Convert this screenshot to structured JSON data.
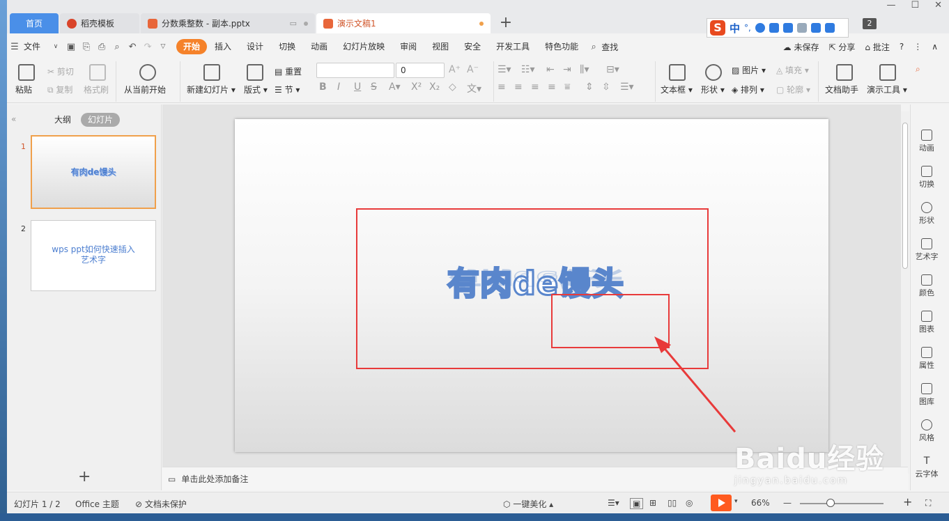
{
  "tabs": {
    "home": "首页",
    "t1": "稻壳模板",
    "t2": "分数乘整数 - 副本.pptx",
    "t3": "演示文稿1"
  },
  "ime": {
    "zh": "中"
  },
  "badge": "2",
  "menu": {
    "file": "文件",
    "items": [
      "开始",
      "插入",
      "设计",
      "切换",
      "动画",
      "幻灯片放映",
      "审阅",
      "视图",
      "安全",
      "开发工具",
      "特色功能"
    ],
    "search": "查找",
    "unsaved": "未保存",
    "share": "分享",
    "comment": "批注"
  },
  "ribbon": {
    "paste": "粘贴",
    "cut": "剪切",
    "copy": "复制",
    "format_painter": "格式刷",
    "from_current": "从当前开始",
    "new_slide": "新建幻灯片",
    "layout": "版式",
    "reset": "重置",
    "section": "节",
    "font_size": "0",
    "textbox": "文本框",
    "shape": "形状",
    "picture": "图片",
    "fill": "填充",
    "arrange": "排列",
    "outline": "轮廓",
    "doc_helper": "文档助手",
    "present_tools": "演示工具"
  },
  "leftpanel": {
    "outline_tab": "大纲",
    "slides_tab": "幻灯片",
    "slide1_num": "1",
    "slide1_title": "有肉de馒头",
    "slide2_num": "2",
    "slide2_title_line1": "wps ppt如何快速插入",
    "slide2_title_line2": "艺术字"
  },
  "slide": {
    "art_text": "有肉de馒头"
  },
  "notes": "单击此处添加备注",
  "rail": [
    "动画",
    "切换",
    "形状",
    "艺术字",
    "颜色",
    "图表",
    "属性",
    "图库",
    "风格",
    "云字体"
  ],
  "status": {
    "slide_info": "幻灯片 1 / 2",
    "theme": "Office 主题",
    "protect": "文档未保护",
    "beautify": "一键美化",
    "zoom": "66%"
  },
  "watermark": {
    "brand": "Baidu经验",
    "url": "jingyan.baidu.com"
  },
  "colors": {
    "accent": "#f5822a",
    "tab_blue": "#4a8fe8",
    "highlight_red": "#e83a3a",
    "art_blue": "#5a86cc"
  }
}
